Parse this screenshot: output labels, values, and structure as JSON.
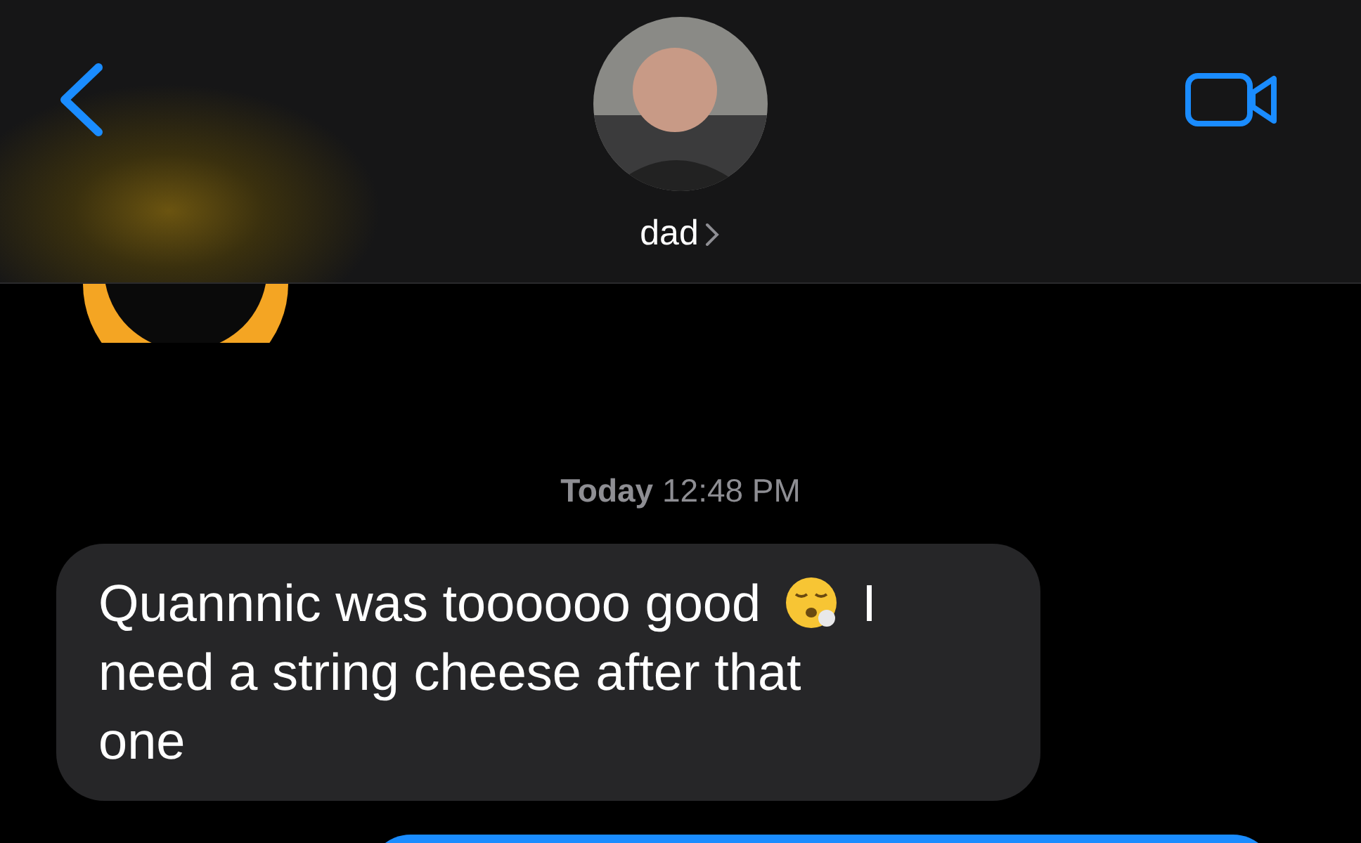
{
  "header": {
    "contact_name": "dad"
  },
  "timestamp": "**Today** 12:48 PM",
  "messages": [
    {
      "kind": "incoming",
      "lines": [
        [
          {
            "kind": "text",
            "text": "Quannnic was toooooo good"
          },
          {
            "kind": "emoji"
          },
          {
            "kind": "text",
            "text": "I"
          }
        ],
        [
          {
            "kind": "text",
            "text": "need a string cheese after that"
          }
        ],
        [
          {
            "kind": "text",
            "text": "one"
          }
        ]
      ]
    },
    {
      "kind": "outgoing"
    }
  ]
}
